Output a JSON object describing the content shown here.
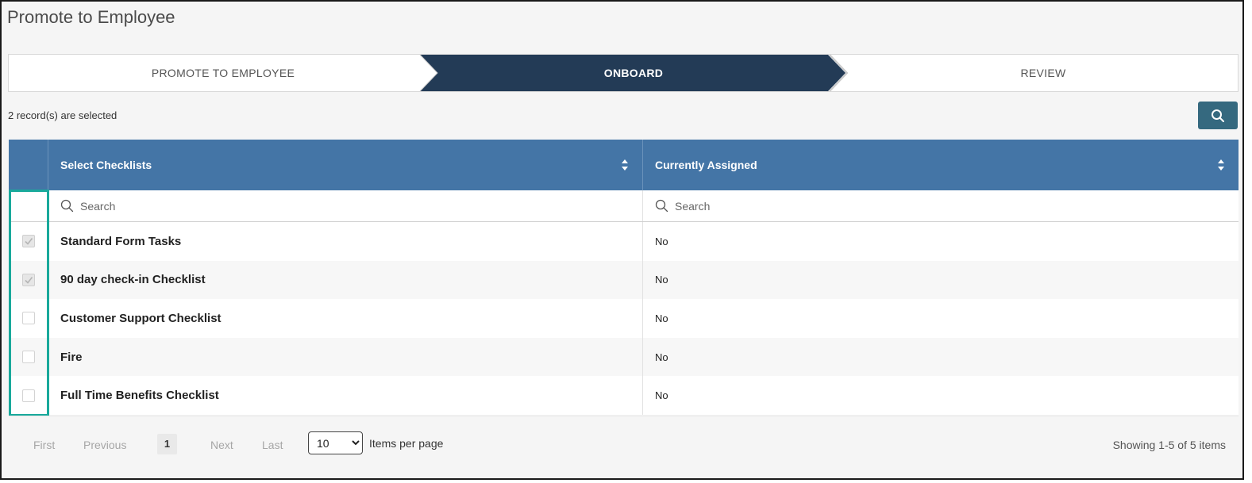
{
  "page": {
    "title": "Promote to Employee"
  },
  "wizard": {
    "steps": [
      {
        "label": "PROMOTE TO EMPLOYEE",
        "active": false
      },
      {
        "label": "ONBOARD",
        "active": true
      },
      {
        "label": "REVIEW",
        "active": false
      }
    ],
    "active_color": "#233b56"
  },
  "selection": {
    "text": "2 record(s) are selected"
  },
  "toolbar": {
    "search_icon": "search-icon"
  },
  "table": {
    "header_color": "#4475a6",
    "columns": [
      {
        "label": "Select Checklists",
        "filter_placeholder": "Search"
      },
      {
        "label": "Currently Assigned",
        "filter_placeholder": "Search"
      }
    ],
    "rows": [
      {
        "name": "Standard Form Tasks",
        "assigned": "No",
        "checked": true
      },
      {
        "name": "90 day check-in Checklist",
        "assigned": "No",
        "checked": true
      },
      {
        "name": "Customer Support Checklist",
        "assigned": "No",
        "checked": false
      },
      {
        "name": "Fire",
        "assigned": "No",
        "checked": false
      },
      {
        "name": "Full Time Benefits Checklist",
        "assigned": "No",
        "checked": false
      }
    ]
  },
  "pager": {
    "first": "First",
    "previous": "Previous",
    "current_page": "1",
    "next": "Next",
    "last": "Last",
    "per_page_value": "10",
    "per_page_label": "Items per page",
    "showing": "Showing 1-5 of 5 items"
  },
  "highlight_color": "#19a99b"
}
